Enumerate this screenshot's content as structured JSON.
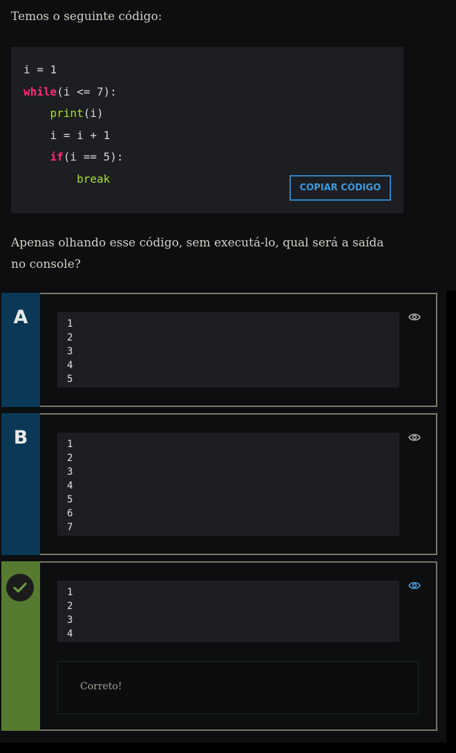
{
  "intro": "Temos o seguinte código:",
  "code": {
    "lines": [
      {
        "pre": "",
        "kw": "",
        "fn": "",
        "text": "i = 1"
      },
      {
        "pre": "",
        "kw": "while",
        "fn": "",
        "text": "(i <= 7):"
      },
      {
        "pre": "    ",
        "kw": "",
        "fn": "print",
        "text": "(i)"
      },
      {
        "pre": "    ",
        "kw": "",
        "fn": "",
        "text": "i = i + 1"
      },
      {
        "pre": "    ",
        "kw": "if",
        "fn": "",
        "text": "(i == 5):"
      },
      {
        "pre": "        ",
        "kw": "",
        "fn": "break",
        "text": ""
      }
    ],
    "copy_label": "COPIAR CÓDIGO"
  },
  "question": "Apenas olhando esse código, sem executá-lo, qual será a saída no console?",
  "options": [
    {
      "letter": "A",
      "lines": [
        "1",
        "2",
        "3",
        "4",
        "5"
      ],
      "correct": false
    },
    {
      "letter": "B",
      "lines": [
        "1",
        "2",
        "3",
        "4",
        "5",
        "6",
        "7"
      ],
      "correct": false
    },
    {
      "letter": "",
      "lines": [
        "1",
        "2",
        "3",
        "4"
      ],
      "correct": true,
      "feedback": "Correto!"
    }
  ],
  "colors": {
    "accent_blue": "#2d86c8",
    "letter_column": "#0a3958",
    "correct_green": "#577a31",
    "keyword": "#ff2d78",
    "function": "#a6e22e",
    "eye_active": "#4aa3e6"
  },
  "icons": {
    "view": "eye-icon",
    "correct": "check-icon"
  }
}
